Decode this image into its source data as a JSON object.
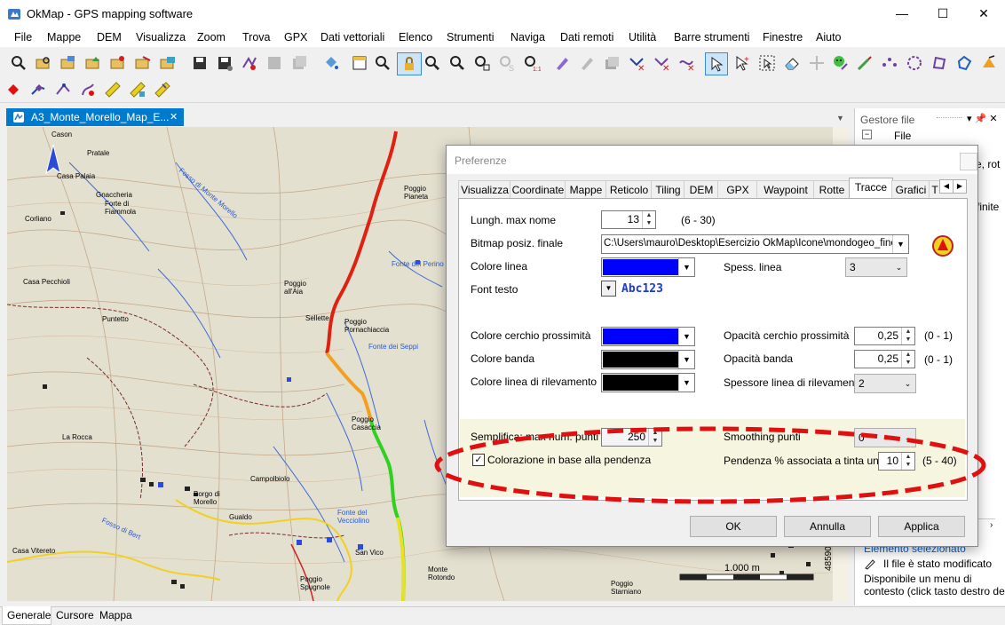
{
  "window": {
    "title": "OkMap - GPS mapping software",
    "minimize": "—",
    "maximize": "☐",
    "close": "✕"
  },
  "menu": [
    "File",
    "Mappe",
    "DEM",
    "Visualizza",
    "Zoom",
    "Trova",
    "GPX",
    "Dati vettoriali",
    "Elenco",
    "Strumenti",
    "Naviga",
    "Dati remoti",
    "Utilità",
    "Barre strumenti",
    "Finestre",
    "Aiuto"
  ],
  "document_tab": {
    "label": "A3_Monte_Morello_Map_E...",
    "close": "✕"
  },
  "map_labels": [
    "Cason",
    "Pratale",
    "Casa Palaia",
    "Gnaccheria",
    "Forte di Fiammola",
    "Corliano",
    "Fosso di Monte Morello",
    "Casa Pecchioli",
    "Puntetto",
    "Poggio all'Aia",
    "Poggio Pianeta",
    "Fonte del Perino",
    "Sellette",
    "Poggio Pornachiaccia",
    "Fonte dei Seppi",
    "Poggio Casaccia",
    "La Rocca",
    "Gualdo",
    "Campolbiolo",
    "Borgo di Morello",
    "Fosso di Bert",
    "Casa Vitereto",
    "Fonte del Vecciolino",
    "San Vico",
    "Poggio Spugnole",
    "Monte Rotondo",
    "Poggio Starniano",
    "1.000 m",
    "4859000"
  ],
  "gestore": {
    "title": "Gestore file",
    "pin": "▾ 📌 ✕",
    "tree_root": "File",
    "cut_text_1": "e, rot",
    "cut_text_2": "finite",
    "selected_title": "Elemento selezionato",
    "status_modified": "Il file è stato modificato",
    "context_menu_1": "Disponibile un menu di",
    "context_menu_2": "contesto (click tasto destro del"
  },
  "bottom_tabs": [
    "Generale",
    "Cursore",
    "Mappa"
  ],
  "dialog": {
    "title": "Preferenze",
    "tabs": [
      "Visualizza",
      "Coordinate",
      "Mappe",
      "Reticolo",
      "Tiling",
      "DEM",
      "GPX",
      "Waypoint",
      "Rotte",
      "Tracce",
      "Grafici",
      "T"
    ],
    "active_tab": "Tracce",
    "fields": {
      "max_name_label": "Lungh. max nome",
      "max_name_value": "13",
      "max_name_range": "(6 - 30)",
      "bitmap_label": "Bitmap posiz. finale",
      "bitmap_value": "C:\\Users\\mauro\\Desktop\\Esercizio OkMap\\Icone\\mondogeo_fine.p",
      "line_color_label": "Colore linea",
      "line_color": "#0000ff",
      "line_width_label": "Spess. linea",
      "line_width_value": "3",
      "font_label": "Font testo",
      "font_sample": "Abc123",
      "prox_color_label": "Colore cerchio prossimità",
      "prox_color": "#0000ff",
      "prox_opacity_label": "Opacità cerchio prossimità",
      "prox_opacity_value": "0,25",
      "prox_opacity_range": "(0 - 1)",
      "band_color_label": "Colore banda",
      "band_color": "#000000",
      "band_opacity_label": "Opacità banda",
      "band_opacity_value": "0,25",
      "band_opacity_range": "(0 - 1)",
      "survey_color_label": "Colore linea di rilevamento",
      "survey_color": "#000000",
      "survey_width_label": "Spessore linea di rilevamento",
      "survey_width_value": "2",
      "simplify_label": "Semplifica: max num. punti",
      "simplify_value": "250",
      "smoothing_label": "Smoothing punti",
      "smoothing_value": "0",
      "slope_color_label": "Colorazione in base alla pendenza",
      "slope_color_checked": true,
      "slope_pct_label": "Pendenza % associata a tinta unita",
      "slope_pct_value": "10",
      "slope_pct_range": "(5 - 40)"
    },
    "buttons": {
      "ok": "OK",
      "cancel": "Annulla",
      "apply": "Applica"
    }
  },
  "colors": {
    "accent": "#007acc",
    "highlight_ellipse": "#e01010",
    "track_red": "#e02010",
    "track_green": "#30d020",
    "track_yellow": "#f0e020"
  }
}
